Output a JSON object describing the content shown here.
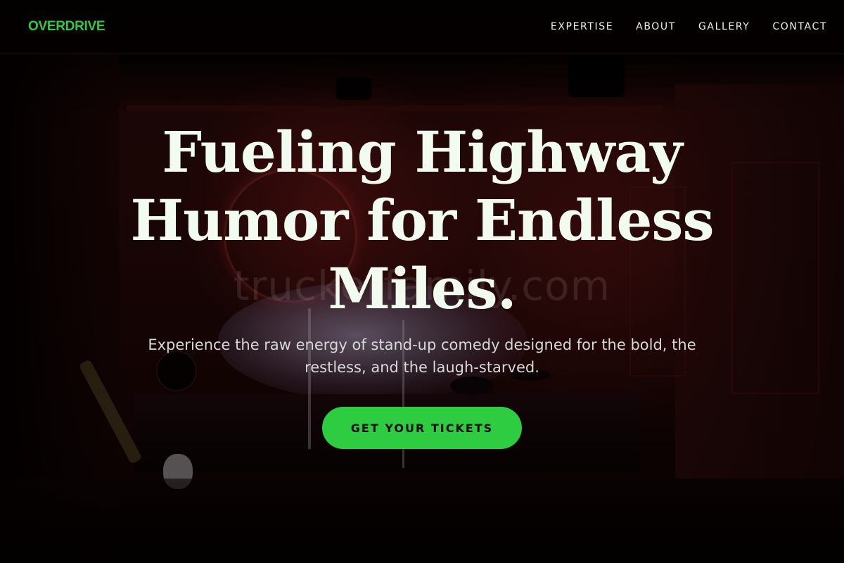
{
  "brand": {
    "name": "OVERDRIVE",
    "color": "#2ecc40"
  },
  "nav": {
    "links": [
      {
        "label": "EXPERTISE"
      },
      {
        "label": "ABOUT"
      },
      {
        "label": "GALLERY"
      },
      {
        "label": "CONTACT"
      }
    ]
  },
  "hero": {
    "title": "Fueling Highway Humor for Endless Miles.",
    "subtitle": "Experience the raw energy of stand-up comedy designed for the bold, the restless, and the laugh-starved.",
    "cta_label": "GET YOUR TICKETS",
    "cta_color": "#2ecc40"
  },
  "watermark": {
    "text": "truckerfamily.com"
  }
}
